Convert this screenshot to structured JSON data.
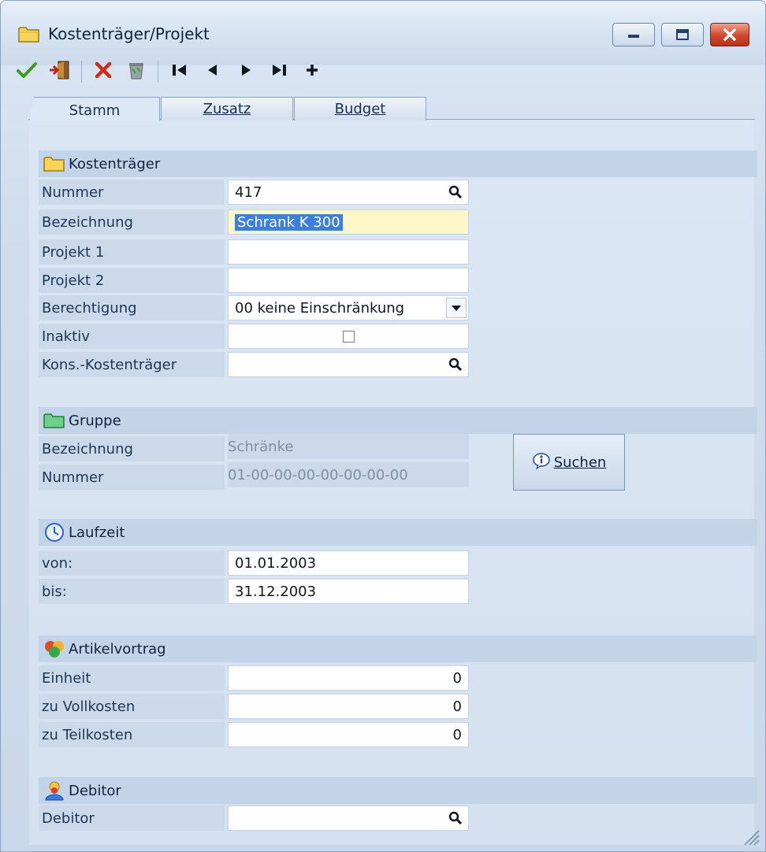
{
  "window": {
    "title": "Kostenträger/Projekt",
    "icon": "folder-icon"
  },
  "toolbar": {
    "items": [
      "confirm-checkmark-icon",
      "exit-door-icon",
      "delete-x-icon",
      "trash-bin-icon",
      "first-record-icon",
      "previous-record-icon",
      "next-record-icon",
      "last-record-icon",
      "add-record-icon"
    ]
  },
  "tabs": [
    {
      "label": "Stamm",
      "active": true
    },
    {
      "label": "Zusatz",
      "active": false
    },
    {
      "label": "Budget",
      "active": false
    }
  ],
  "kostentraeger": {
    "header": "Kostenträger",
    "nummer_label": "Nummer",
    "nummer_value": "417",
    "bezeichnung_label": "Bezeichnung",
    "bezeichnung_value": "Schrank K 300",
    "projekt1_label": "Projekt 1",
    "projekt1_value": "",
    "projekt2_label": "Projekt 2",
    "projekt2_value": "",
    "berechtigung_label": "Berechtigung",
    "berechtigung_value": "00 keine Einschränkung",
    "inaktiv_label": "Inaktiv",
    "inaktiv_checked": false,
    "kons_label": "Kons.-Kostenträger",
    "kons_value": ""
  },
  "gruppe": {
    "header": "Gruppe",
    "bezeichnung_label": "Bezeichnung",
    "bezeichnung_value": "Schränke",
    "nummer_label": "Nummer",
    "nummer_value": "01-00-00-00-00-00-00-00",
    "suchen_label": "Suchen"
  },
  "laufzeit": {
    "header": "Laufzeit",
    "von_label": "von:",
    "von_value": "01.01.2003",
    "bis_label": "bis:",
    "bis_value": "31.12.2003"
  },
  "artikelvortrag": {
    "header": "Artikelvortrag",
    "einheit_label": "Einheit",
    "einheit_value": "0",
    "vollkosten_label": "zu Vollkosten",
    "vollkosten_value": "0",
    "teilkosten_label": "zu Teilkosten",
    "teilkosten_value": "0"
  },
  "debitor": {
    "header": "Debitor",
    "debitor_label": "Debitor",
    "debitor_value": ""
  },
  "colors": {
    "accent": "#3d7fd9",
    "close_button": "#d0482c",
    "highlight_field": "#fff7c8",
    "section_header": "#c3d3e8"
  }
}
